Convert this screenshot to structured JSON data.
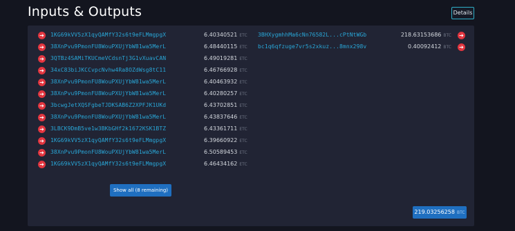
{
  "header": {
    "title": "Inputs & Outputs",
    "details_label": "Details"
  },
  "unit": "ETC",
  "inputs": [
    {
      "address": "1KG69kVV5zX1qyQAMfY32s6t9eFLMmgpgX",
      "amount": "6.40340521"
    },
    {
      "address": "38XnPvu9PmonFU8WouPXUjYbW81wa5MerL",
      "amount": "6.48440115"
    },
    {
      "address": "3QTBz4SAMiTKUCmeVCdsnTj3G1vXuavCAN",
      "amount": "6.49019281"
    },
    {
      "address": "34xC83biJKCCvpcNvhw4Ra8OZdWsg8tC11",
      "amount": "6.46766928"
    },
    {
      "address": "38XnPvu9PmonFU8WouPXUjYbW81wa5MerL",
      "amount": "6.40463932"
    },
    {
      "address": "38XnPvu9PmonFU8WouPXUjYbW81wa5MerL",
      "amount": "6.40280257"
    },
    {
      "address": "3bcwgJetXQSFgbeTJDKSAB6Z2XPFJK1UKd",
      "amount": "6.43702851"
    },
    {
      "address": "38XnPvu9PmonFU8WouPXUjYbW81wa5MerL",
      "amount": "6.43837646"
    },
    {
      "address": "3LBCK9DmB5ve1w3BKbGHf2k1672KSK1BTZ",
      "amount": "6.43361711"
    },
    {
      "address": "1KG69kVV5zX1qyQAMfY32s6t9eFLMmgpgX",
      "amount": "6.39660922"
    },
    {
      "address": "38XnPvu9PmonFU8WouPXUjYbW81wa5MerL",
      "amount": "6.50589453"
    },
    {
      "address": "1KG69kVV5zX1qyQAMfY32s6t9eFLMmgpgX",
      "amount": "6.46434162"
    }
  ],
  "outputs": [
    {
      "address": "3BHXygmhhMa6cNn76582L...cPtNtWGb",
      "amount": "218.63153686",
      "unit": "BTC"
    },
    {
      "address": "bc1q6qfzuge7vr5s2xkuz...8mnx298v",
      "amount": "0.40092412",
      "unit": "BTC"
    }
  ],
  "show_all_label": "Show all (8 remaining)",
  "total": {
    "amount": "219.03256258",
    "unit": "BTC"
  }
}
